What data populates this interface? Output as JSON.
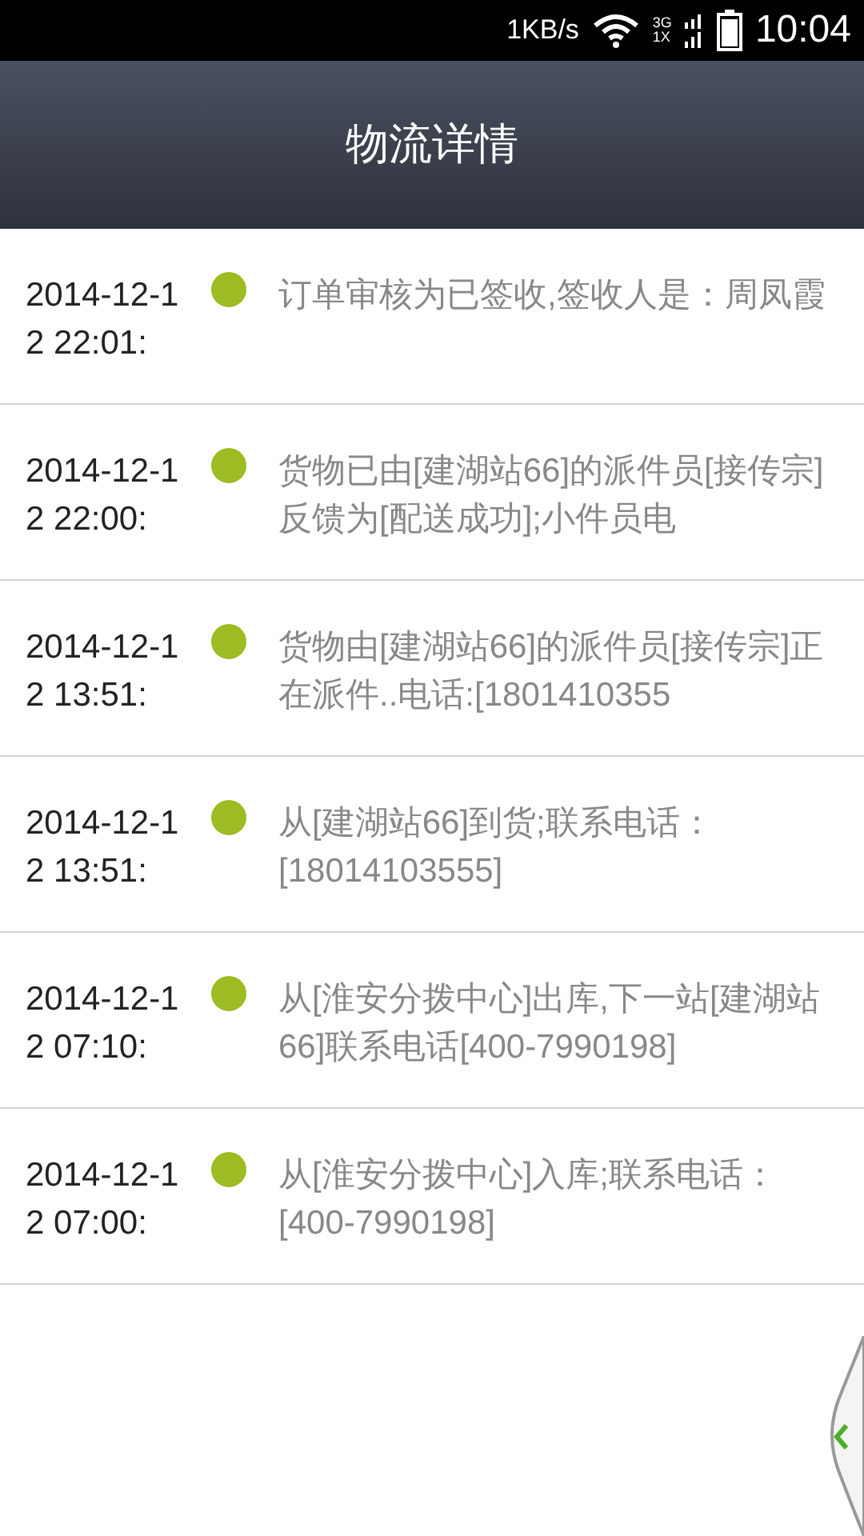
{
  "status_bar": {
    "speed": "1KB/s",
    "network_top": "3G",
    "network_bottom": "1X",
    "time": "10:04"
  },
  "header": {
    "title": "物流详情"
  },
  "events": [
    {
      "time": "2014-12-12 22:01:",
      "text": "订单审核为已签收,签收人是：周凤霞"
    },
    {
      "time": "2014-12-12 22:00:",
      "text": "货物已由[建湖站66]的派件员[接传宗]反馈为[配送成功];小件员电"
    },
    {
      "time": "2014-12-12 13:51:",
      "text": "货物由[建湖站66]的派件员[接传宗]正在派件..电话:[1801410355"
    },
    {
      "time": "2014-12-12 13:51:",
      "text": "从[建湖站66]到货;联系电话：[18014103555]"
    },
    {
      "time": "2014-12-12 07:10:",
      "text": "从[淮安分拨中心]出库,下一站[建湖站66]联系电话[400-7990198]"
    },
    {
      "time": "2014-12-12 07:00:",
      "text": "从[淮安分拨中心]入库;联系电话：[400-7990198]"
    }
  ]
}
